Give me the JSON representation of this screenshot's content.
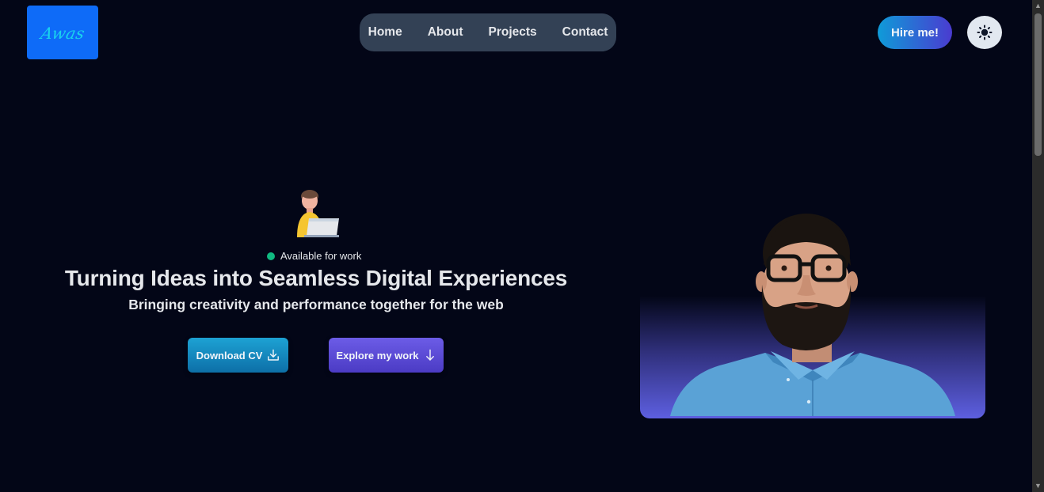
{
  "logo": {
    "text": "Awas",
    "bg_color": "#0e6bf8",
    "text_color": "#19d3ee"
  },
  "nav": {
    "items": [
      {
        "label": "Home"
      },
      {
        "label": "About"
      },
      {
        "label": "Projects"
      },
      {
        "label": "Contact"
      }
    ]
  },
  "header": {
    "hire_label": "Hire me!",
    "theme_icon": "sun-icon"
  },
  "hero": {
    "avatar_icon": "person-with-laptop-icon",
    "status_text": "Available for work",
    "status_color": "#10b981",
    "headline": "Turning Ideas into Seamless Digital Experiences",
    "subheadline": "Bringing creativity and performance together for the web",
    "download_cv_label": "Download CV",
    "download_icon": "download-icon",
    "explore_label": "Explore my work",
    "explore_icon": "arrow-down-icon"
  },
  "colors": {
    "background": "#030617",
    "nav_bg": "#334155",
    "accent_blue": "#0f9bd8",
    "accent_purple": "#4a3bd0"
  }
}
